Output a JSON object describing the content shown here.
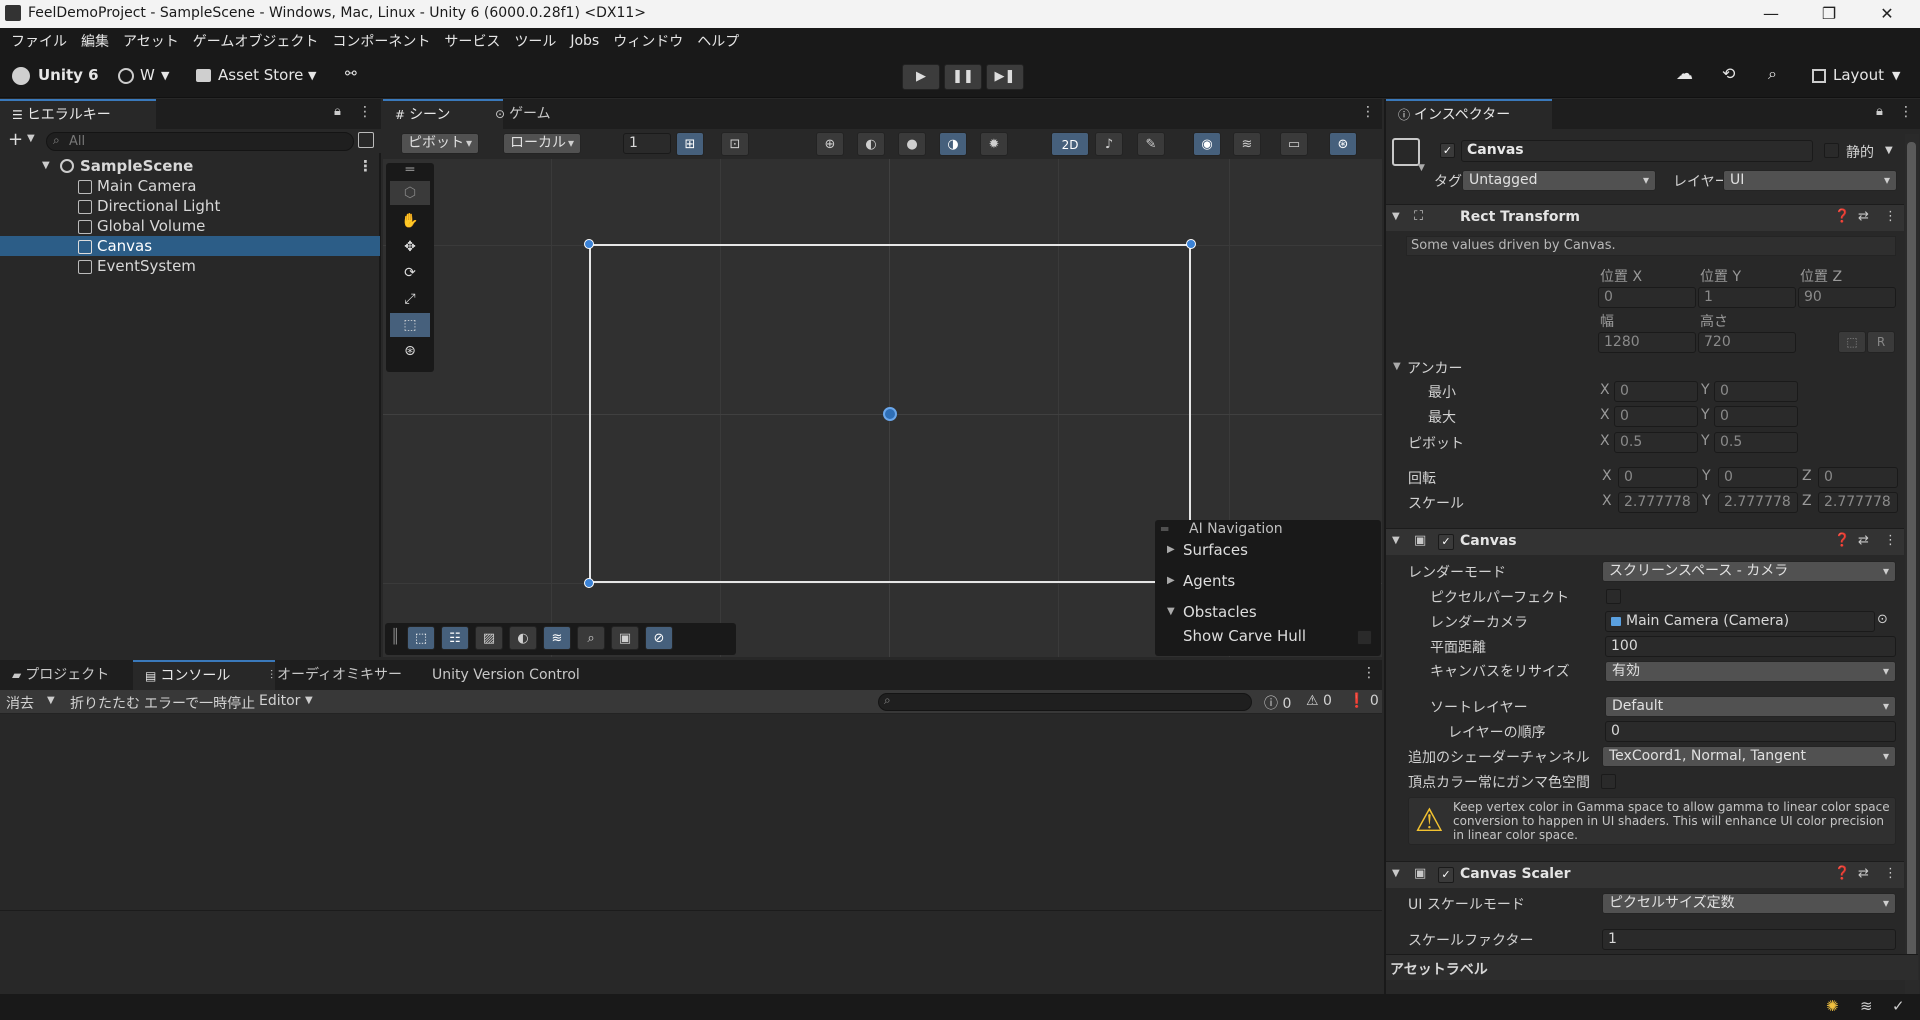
{
  "window": {
    "title": "FeelDemoProject - SampleScene - Windows, Mac, Linux - Unity 6 (6000.0.28f1) <DX11>",
    "minimize": "—",
    "maximize": "❐",
    "close": "✕"
  },
  "menu": [
    "ファイル",
    "編集",
    "アセット",
    "ゲームオブジェクト",
    "コンポーネント",
    "サービス",
    "ツール",
    "Jobs",
    "ウィンドウ",
    "ヘルプ"
  ],
  "toolbar": {
    "unity_label": "Unity 6",
    "account_label": "W",
    "asset_store": "Asset Store",
    "layout": "Layout",
    "play": "▶",
    "pause": "❚❚",
    "step": "▶❚"
  },
  "hierarchy": {
    "tab": "ヒエラルキー",
    "search_placeholder": "All",
    "add": "+",
    "scene": "SampleScene",
    "items": [
      "Main Camera",
      "Directional Light",
      "Global Volume",
      "Canvas",
      "EventSystem"
    ],
    "selected_index": 3
  },
  "scene": {
    "tabs": [
      "シーン",
      "ゲーム"
    ],
    "pivot": "ピボット",
    "local": "ローカル",
    "grid_value": "1",
    "mode_2d": "2D",
    "overlay": {
      "title": "AI Navigation",
      "surfaces": "Surfaces",
      "agents": "Agents",
      "obstacles": "Obstacles",
      "show_carve_hull": "Show Carve Hull"
    }
  },
  "bottom": {
    "tabs": [
      "プロジェクト",
      "コンソール",
      "オーディオミキサー",
      "Unity Version Control"
    ],
    "active_tab": 1,
    "clear": "消去",
    "collapse": "折りたたむ",
    "error_pause": "エラーで一時停止",
    "editor": "Editor",
    "count_log": "0",
    "count_warn": "0",
    "count_error": "0"
  },
  "inspector": {
    "tab": "インスペクター",
    "object_name": "Canvas",
    "static_label": "静的",
    "tag_label": "タグ",
    "tag_value": "Untagged",
    "layer_label": "レイヤー",
    "layer_value": "UI",
    "rect_transform": {
      "title": "Rect Transform",
      "note": "Some values driven by Canvas.",
      "pos_x_label": "位置 X",
      "pos_y_label": "位置 Y",
      "pos_z_label": "位置 Z",
      "pos_x": "0",
      "pos_y": "1",
      "pos_z": "90",
      "width_label": "幅",
      "height_label": "高さ",
      "width": "1280",
      "height": "720",
      "anchor_label": "アンカー",
      "min_label": "最小",
      "max_label": "最大",
      "min_x": "0",
      "min_y": "0",
      "max_x": "0",
      "max_y": "0",
      "pivot_label": "ピボット",
      "pivot_x": "0.5",
      "pivot_y": "0.5",
      "rotation_label": "回転",
      "rot_x": "0",
      "rot_y": "0",
      "rot_z": "0",
      "scale_label": "スケール",
      "scale_x": "2.777778",
      "scale_y": "2.777778",
      "scale_z": "2.777778",
      "axis_x": "X",
      "axis_y": "Y",
      "axis_z": "Z",
      "blueprint_btn": "R"
    },
    "canvas": {
      "title": "Canvas",
      "render_mode_label": "レンダーモード",
      "render_mode": "スクリーンスペース - カメラ",
      "pixel_perfect_label": "ピクセルパーフェクト",
      "render_camera_label": "レンダーカメラ",
      "render_camera": "Main Camera (Camera)",
      "plane_distance_label": "平面距離",
      "plane_distance": "100",
      "resize_label": "キャンバスをリサイズ",
      "resize": "有効",
      "sorting_layer_label": "ソートレイヤー",
      "sorting_layer": "Default",
      "order_label": "レイヤーの順序",
      "order": "0",
      "shader_channels_label": "追加のシェーダーチャンネル",
      "shader_channels": "TexCoord1, Normal, Tangent",
      "gamma_label": "頂点カラー常にガンマ色空間",
      "warning": "Keep vertex color in Gamma space to allow gamma to linear color space conversion to happen in UI shaders. This will enhance UI color precision in linear color space."
    },
    "canvas_scaler": {
      "title": "Canvas Scaler",
      "scale_mode_label": "UI スケールモード",
      "scale_mode": "ピクセルサイズ定数",
      "scale_factor_label": "スケールファクター",
      "scale_factor": "1"
    },
    "asset_label": "アセットラベル"
  },
  "colors": {
    "accent": "#3a79bb",
    "selection": "#2c5d87",
    "panel": "#282828",
    "dark": "#191919"
  }
}
